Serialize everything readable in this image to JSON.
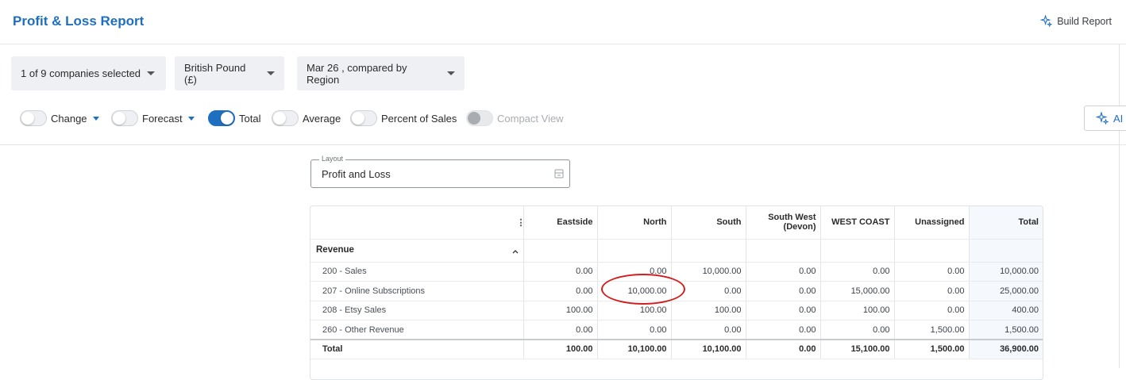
{
  "header": {
    "title": "Profit & Loss Report",
    "build_report_label": "Build Report"
  },
  "filters": {
    "companies": "1 of 9 companies selected",
    "currency": "British Pound (£)",
    "period": "Mar 26 , compared by Region"
  },
  "toggles": {
    "change": {
      "label": "Change",
      "on": false
    },
    "forecast": {
      "label": "Forecast",
      "on": false
    },
    "total": {
      "label": "Total",
      "on": true
    },
    "average": {
      "label": "Average",
      "on": false
    },
    "percent_of_sales": {
      "label": "Percent of Sales",
      "on": false
    },
    "compact_view": {
      "label": "Compact View",
      "on": false,
      "disabled": true
    }
  },
  "ai_button_label": "AI",
  "layout": {
    "legend": "Layout",
    "value": "Profit and Loss"
  },
  "table": {
    "columns": [
      "Eastside",
      "North",
      "South",
      "South West (Devon)",
      "WEST COAST",
      "Unassigned",
      "Total"
    ],
    "group": "Revenue",
    "rows": [
      {
        "name": "200 - Sales",
        "values": [
          "0.00",
          "0.00",
          "10,000.00",
          "0.00",
          "0.00",
          "0.00",
          "10,000.00"
        ]
      },
      {
        "name": "207 - Online Subscriptions",
        "values": [
          "0.00",
          "10,000.00",
          "0.00",
          "0.00",
          "15,000.00",
          "0.00",
          "25,000.00"
        ]
      },
      {
        "name": "208 - Etsy Sales",
        "values": [
          "100.00",
          "100.00",
          "100.00",
          "0.00",
          "100.00",
          "0.00",
          "400.00"
        ]
      },
      {
        "name": "260 - Other Revenue",
        "values": [
          "0.00",
          "0.00",
          "0.00",
          "0.00",
          "0.00",
          "1,500.00",
          "1,500.00"
        ]
      }
    ],
    "total": {
      "name": "Total",
      "values": [
        "100.00",
        "10,100.00",
        "10,100.00",
        "0.00",
        "15,100.00",
        "1,500.00",
        "36,900.00"
      ]
    }
  },
  "colors": {
    "accent": "#1f6fc1",
    "annotation": "#d11f1f"
  }
}
